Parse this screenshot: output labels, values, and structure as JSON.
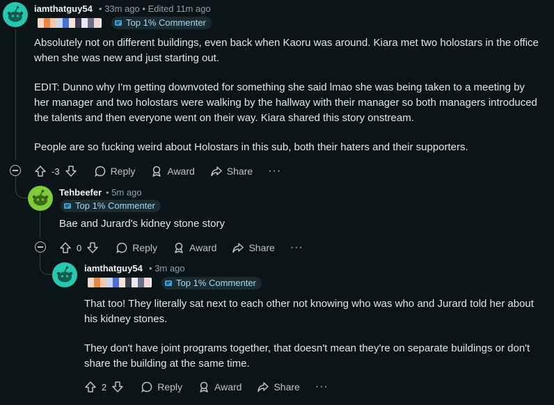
{
  "comments": [
    {
      "username": "iamthatguy54",
      "time": "33m ago",
      "edited": "Edited 11m ago",
      "badge": "Top 1% Commenter",
      "paragraphs": [
        "Absolutely not on different buildings, even back when Kaoru was around. Kiara met two holostars in the office when she was new and just starting out.",
        "EDIT: Dunno why I'm getting downvoted for something she said lmao she was being taken to a meeting by her manager and two holostars were walking by the hallway with their manager so both managers introduced the talents and then everyone went on their way. Kiara shared this story onstream.",
        "People are so fucking weird about Holostars in this sub, both their haters and their supporters."
      ],
      "score": "-3"
    },
    {
      "username": "Tehbeefer",
      "time": "5m ago",
      "badge": "Top 1% Commenter",
      "paragraphs": [
        "Bae and Jurard's kidney stone story"
      ],
      "score": "0"
    },
    {
      "username": "iamthatguy54",
      "time": "3m ago",
      "badge": "Top 1% Commenter",
      "paragraphs": [
        "That too! They literally sat next to each other not knowing who was who and Jurard told her about his kidney stones.",
        "They don't have joint programs together, that doesn't mean they're on separate buildings or don't share the building at the same time."
      ],
      "score": "2"
    }
  ],
  "actions": {
    "reply": "Reply",
    "award": "Award",
    "share": "Share",
    "more": "···"
  },
  "separator": "•",
  "colors": {
    "background": "#0b1416",
    "avatar_teal": "#26c9b0",
    "avatar_green": "#7ecb3c",
    "badge_text": "#9fd8f5"
  },
  "icons": [
    "snoo-avatar-icon",
    "upvote-icon",
    "downvote-icon",
    "reply-bubble-icon",
    "award-icon",
    "share-arrow-icon",
    "more-icon",
    "collapse-icon",
    "commenter-badge-icon"
  ]
}
